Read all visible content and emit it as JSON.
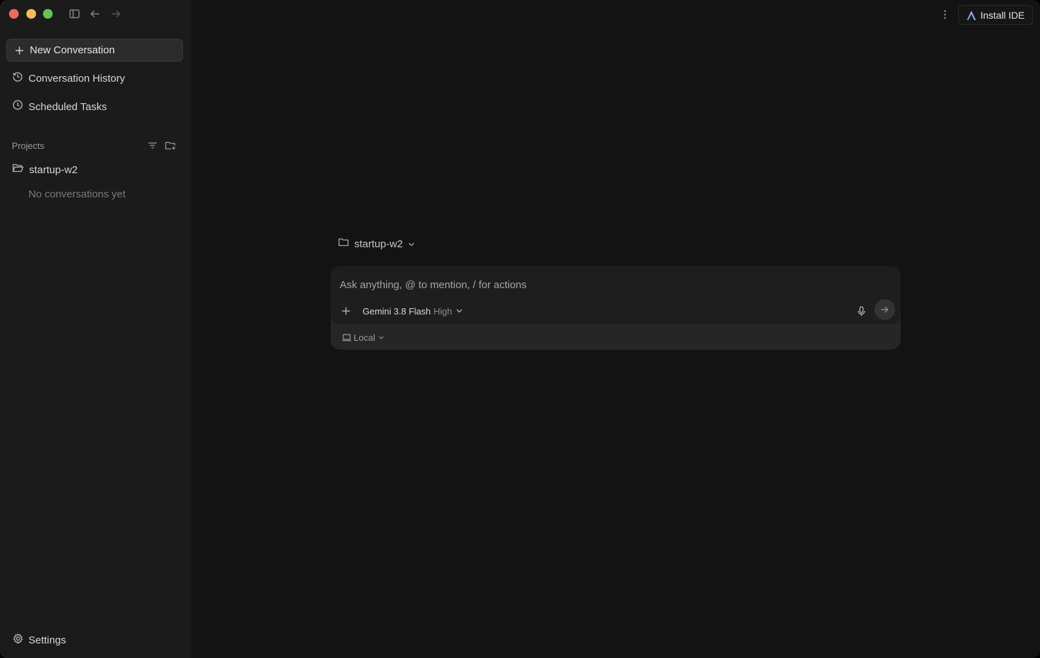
{
  "titlebar": {
    "icons": [
      "sidebar-toggle-icon",
      "arrow-left-icon",
      "arrow-right-icon"
    ],
    "more_icon": "more-vertical-icon",
    "install_ide_label": "Install IDE"
  },
  "sidebar": {
    "new_conversation_label": "New Conversation",
    "nav": {
      "history_label": "Conversation History",
      "scheduled_label": "Scheduled Tasks"
    },
    "projects": {
      "header": "Projects",
      "items": [
        {
          "name": "startup-w2",
          "empty_text": "No conversations yet"
        }
      ]
    },
    "settings_label": "Settings"
  },
  "main": {
    "project_selector_label": "startup-w2",
    "composer": {
      "placeholder": "Ask anything, @ to mention, / for actions",
      "value": "",
      "model_name": "Gemini 3.8 Flash",
      "model_level": "High",
      "environment_label": "Local"
    }
  },
  "colors": {
    "sidebar_bg": "#1b1b1b",
    "main_bg": "#131313",
    "close": "#ed6a5e",
    "minimize": "#f4bf4f",
    "zoom": "#61c554"
  }
}
